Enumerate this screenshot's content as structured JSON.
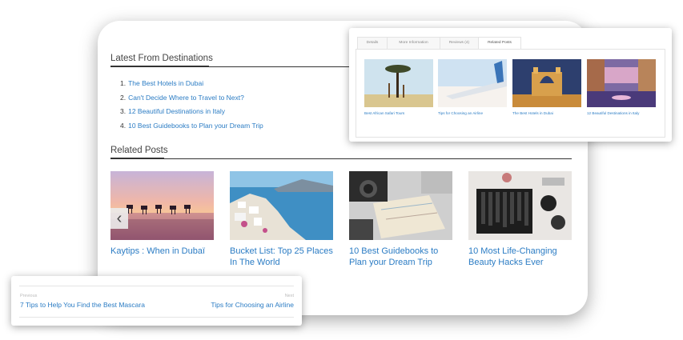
{
  "latest": {
    "heading": "Latest From Destinations",
    "items": [
      {
        "num": "1.",
        "label": "The Best Hotels in Dubai"
      },
      {
        "num": "2.",
        "label": "Can't Decide Where to Travel to Next?"
      },
      {
        "num": "3.",
        "label": "12 Beautiful Destinations in Italy"
      },
      {
        "num": "4.",
        "label": "10 Best Guidebooks to Plan your Dream Trip"
      }
    ]
  },
  "related": {
    "heading": "Related Posts",
    "posts": [
      {
        "title": "Kaytips : When in Dubaï",
        "image": "camel-caravan-sunset"
      },
      {
        "title": "Bucket List: Top 25 Places In The World",
        "image": "santorini-coast"
      },
      {
        "title": "10 Best Guidebooks to Plan your Dream Trip",
        "image": "map-and-camera"
      },
      {
        "title": "10 Most Life-Changing Beauty Hacks Ever",
        "image": "makeup-brushes"
      }
    ],
    "prev_arrow": "‹"
  },
  "tabs_panel": {
    "tabs": [
      "Details",
      "More Information",
      "Reviews (4)",
      "Related Posts"
    ],
    "active_tab": "Related Posts",
    "items": [
      {
        "caption": "Best African Safari Tours",
        "image": "acacia-giraffes"
      },
      {
        "caption": "Tips for Choosing an Airline",
        "image": "airplane-wing"
      },
      {
        "caption": "The Best Hotels in Dubai",
        "image": "atlantis-hotel"
      },
      {
        "caption": "12 Beautiful Destinations in Italy",
        "image": "venice-canal"
      }
    ]
  },
  "post_nav": {
    "previous_label": "Previous",
    "previous_title": "7 Tips to Help You Find the Best Mascara",
    "next_label": "Next",
    "next_title": "Tips for Choosing an Airline"
  },
  "colors": {
    "link": "#2b7cc4",
    "heading": "#444444",
    "rule": "#333333"
  }
}
